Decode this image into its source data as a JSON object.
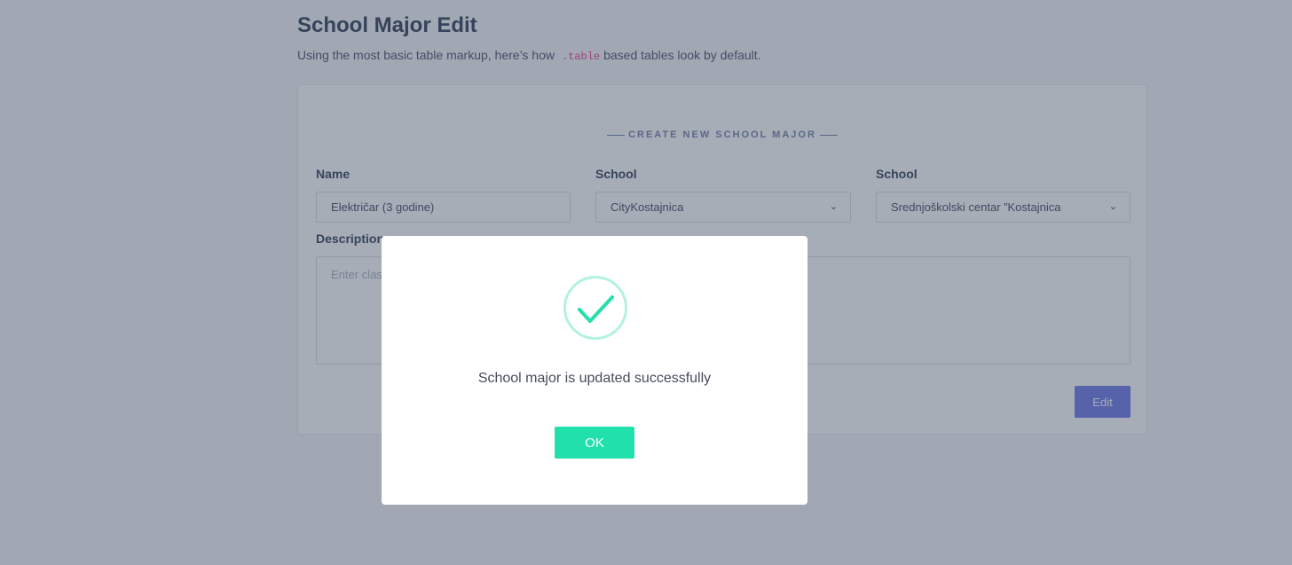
{
  "page": {
    "title": "School Major Edit",
    "subtitle_before": "Using the most basic table markup, here’s how",
    "subtitle_code": ".table",
    "subtitle_after": "based tables look by default."
  },
  "form": {
    "section_title": "CREATE NEW SCHOOL MAJOR",
    "name_label": "Name",
    "name_value": "Električar (3 godine)",
    "school_label_1": "School",
    "school_value_1": "CityKostajnica",
    "school_label_2": "School",
    "school_value_2": "Srednjoškolski centar ”Kostajnica",
    "description_label": "Description",
    "description_placeholder": "Enter class description",
    "edit_button": "Edit"
  },
  "modal": {
    "message": "School major is updated successfully",
    "ok_button": "OK",
    "icon": "check-icon"
  },
  "colors": {
    "primary": "#6975e8",
    "success": "#22e0ac",
    "success_ring": "#b2f2de"
  }
}
